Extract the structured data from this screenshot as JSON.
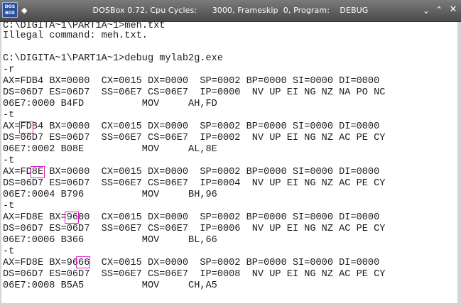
{
  "window": {
    "title": "DOSBox 0.72, Cpu Cycles:      3000, Frameskip  0, Program:    DEBUG",
    "icon_line1": "DOS",
    "icon_line2": "BOX",
    "menu_glyph": "◆",
    "minimize_glyph": "⌃",
    "maximize_glyph": "⌃",
    "close_glyph": "✕"
  },
  "console": {
    "lines": [
      "C:\\DIGITA~1\\PART1A~1>meh.txt",
      "Illegal command: meh.txt.",
      "",
      "C:\\DIGITA~1\\PART1A~1>debug mylab2g.exe",
      "-r",
      "AX=FDB4 BX=0000  CX=0015 DX=0000  SP=0002 BP=0000 SI=0000 DI=0000",
      "DS=06D7 ES=06D7  SS=06E7 CS=06E7  IP=0000  NV UP EI NG NZ NA PO NC",
      "06E7:0000 B4FD          MOV     AH,FD",
      "-t",
      "AX=FDB4 BX=0000  CX=0015 DX=0000  SP=0002 BP=0000 SI=0000 DI=0000",
      "DS=06D7 ES=06D7  SS=06E7 CS=06E7  IP=0002  NV UP EI NG NZ AC PE CY",
      "06E7:0002 B08E          MOV     AL,8E",
      "-t",
      "AX=FD8E BX=0000  CX=0015 DX=0000  SP=0002 BP=0000 SI=0000 DI=0000",
      "DS=06D7 ES=06D7  SS=06E7 CS=06E7  IP=0004  NV UP EI NG NZ AC PE CY",
      "06E7:0004 B796          MOV     BH,96",
      "-t",
      "AX=FD8E BX=9600  CX=0015 DX=0000  SP=0002 BP=0000 SI=0000 DI=0000",
      "DS=06D7 ES=06D7  SS=06E7 CS=06E7  IP=0006  NV UP EI NG NZ AC PE CY",
      "06E7:0006 B366          MOV     BL,66",
      "-t",
      "AX=FD8E BX=9666  CX=0015 DX=0000  SP=0002 BP=0000 SI=0000 DI=0000",
      "DS=06D7 ES=06D7  SS=06E7 CS=06E7  IP=0008  NV UP EI NG NZ AC PE CY",
      "06E7:0008 B5A5          MOV     CH,A5"
    ]
  }
}
